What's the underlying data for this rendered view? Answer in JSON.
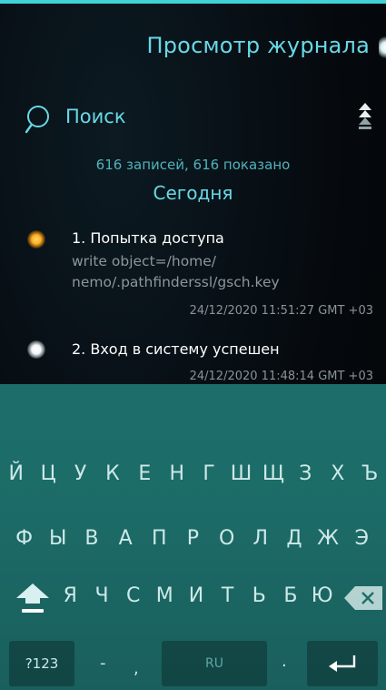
{
  "header": {
    "title": "Просмотр журнала"
  },
  "search": {
    "placeholder": "Поиск"
  },
  "summary": {
    "count_text": "616 записей, 616 показано",
    "section": "Сегодня"
  },
  "entries": [
    {
      "title": "1. Попытка доступа",
      "detail_line1": "write object=/home/",
      "detail_line2": "nemo/.pathfinderssl/gsch.key",
      "time": "24/12/2020 11:51:27 GMT +03",
      "status": "warning",
      "status_color": "#ffb21e"
    },
    {
      "title": "2. Вход в систему успешен",
      "time": "24/12/2020 11:48:14 GMT +03",
      "status": "ok",
      "status_color": "#ffffff"
    }
  ],
  "keyboard": {
    "row1": [
      "Й",
      "Ц",
      "У",
      "К",
      "Е",
      "Н",
      "Г",
      "Ш",
      "Щ",
      "З",
      "Х",
      "Ъ"
    ],
    "row2": [
      "Ф",
      "Ы",
      "В",
      "А",
      "П",
      "Р",
      "О",
      "Л",
      "Д",
      "Ж",
      "Э"
    ],
    "row3": [
      "Я",
      "Ч",
      "С",
      "М",
      "И",
      "Т",
      "Ь",
      "Б",
      "Ю"
    ],
    "symbols_label": "?123",
    "dash": "-",
    "comma": ",",
    "language_label": "RU",
    "period": ".",
    "shift_icon": "shift-icon",
    "backspace_icon": "backspace-icon",
    "enter_icon": "enter-icon"
  },
  "colors": {
    "accent": "#69d8e6",
    "keyboard_bg": "#1d6e6a"
  }
}
